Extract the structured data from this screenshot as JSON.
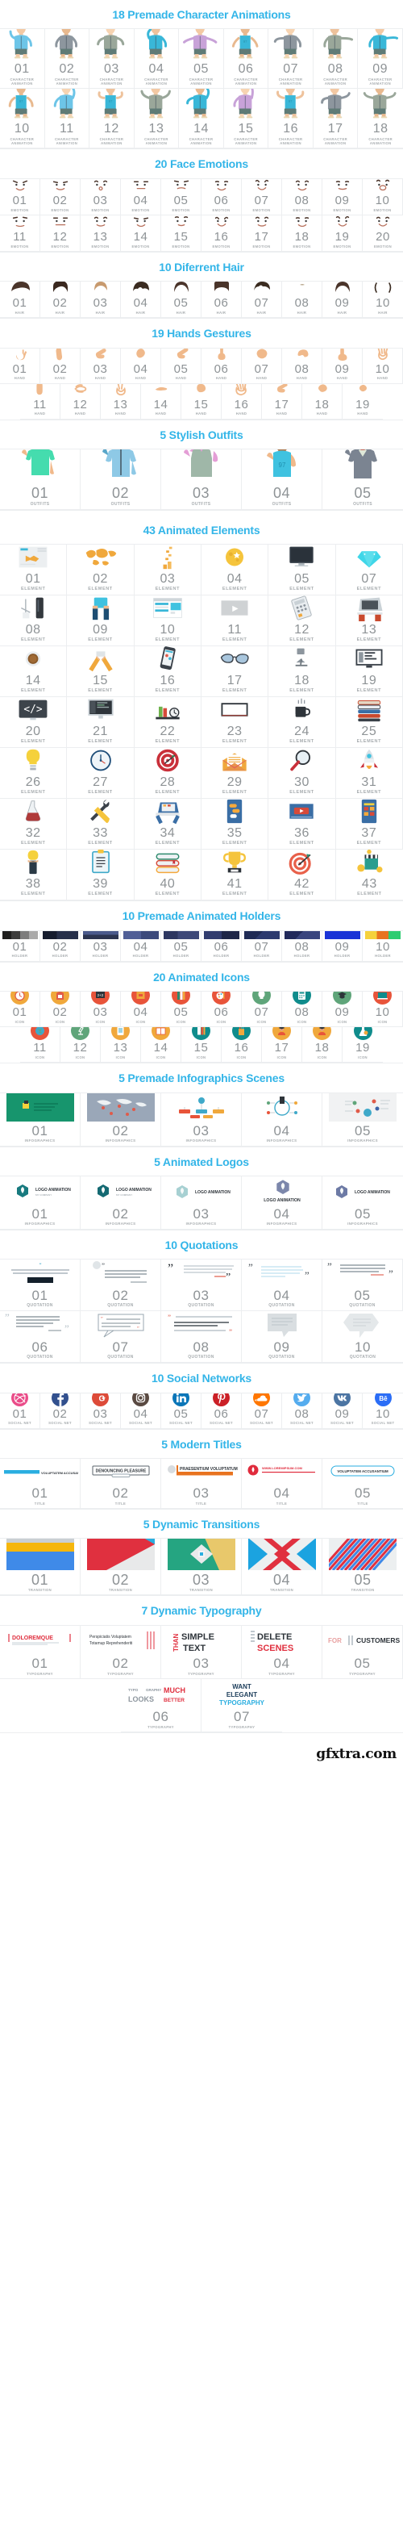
{
  "accent_color": "#33b5e8",
  "sections": [
    {
      "id": "characters",
      "title": "18 Premade Character Animations",
      "caption": "CHARACTER\nANIMATION",
      "items": [
        "01",
        "02",
        "03",
        "04",
        "05",
        "06",
        "07",
        "08",
        "09",
        "10",
        "11",
        "12",
        "13",
        "14",
        "15",
        "16",
        "17",
        "18"
      ]
    },
    {
      "id": "emotions",
      "title": "20 Face Emotions",
      "caption": "EMOTION",
      "items": [
        "01",
        "02",
        "03",
        "04",
        "05",
        "06",
        "07",
        "08",
        "09",
        "10",
        "11",
        "12",
        "13",
        "14",
        "15",
        "16",
        "17",
        "18",
        "19",
        "20"
      ]
    },
    {
      "id": "hair",
      "title": "10 Diferrent Hair",
      "caption": "HAIR",
      "items": [
        "01",
        "02",
        "03",
        "04",
        "05",
        "06",
        "07",
        "08",
        "09",
        "10"
      ]
    },
    {
      "id": "hands",
      "title": "19 Hands Gestures",
      "caption": "HAND",
      "items": [
        "01",
        "02",
        "03",
        "04",
        "05",
        "06",
        "07",
        "08",
        "09",
        "10",
        "11",
        "12",
        "13",
        "14",
        "15",
        "16",
        "17",
        "18",
        "19"
      ]
    },
    {
      "id": "outfits",
      "title": "5 Stylish Outfits",
      "caption": "OUTFITS",
      "items": [
        "01",
        "02",
        "03",
        "04",
        "05"
      ]
    },
    {
      "id": "elements",
      "title": "43 Animated Elements",
      "caption": "ELEMENT",
      "items": [
        "01",
        "02",
        "03",
        "04",
        "05",
        "07",
        "08",
        "09",
        "10",
        "11",
        "12",
        "13",
        "14",
        "15",
        "16",
        "17",
        "18",
        "19",
        "20",
        "21",
        "22",
        "23",
        "24",
        "25",
        "26",
        "27",
        "28",
        "29",
        "30",
        "31",
        "32",
        "33",
        "34",
        "35",
        "36",
        "37",
        "38",
        "39",
        "40",
        "41",
        "42",
        "43"
      ]
    },
    {
      "id": "holders",
      "title": "10 Premade Animated Holders",
      "caption": "HOLDER",
      "items": [
        "01",
        "02",
        "03",
        "04",
        "05",
        "06",
        "07",
        "08",
        "09",
        "10"
      ]
    },
    {
      "id": "icons",
      "title": "20 Animated Icons",
      "caption": "ICON",
      "items": [
        "01",
        "02",
        "03",
        "04",
        "05",
        "06",
        "07",
        "08",
        "09",
        "10",
        "11",
        "12",
        "13",
        "14",
        "15",
        "16",
        "17",
        "18",
        "19"
      ]
    },
    {
      "id": "infographics",
      "title": "5 Premade Infographics Scenes",
      "caption": "INFOGRAPHICS",
      "items": [
        "01",
        "02",
        "03",
        "04",
        "05"
      ]
    },
    {
      "id": "logos",
      "title": "5 Animated Logos",
      "caption": "INFOGRAPHICS",
      "items": [
        "01",
        "02",
        "03",
        "04",
        "05"
      ],
      "logo_text": "LOGO ANIMATION",
      "logo_sub": "MY COMPANY"
    },
    {
      "id": "quotations",
      "title": "10 Quotations",
      "caption": "QUOTATION",
      "items": [
        "01",
        "02",
        "03",
        "04",
        "05",
        "06",
        "07",
        "08",
        "09",
        "10"
      ]
    },
    {
      "id": "social",
      "title": "10 Social Networks",
      "caption": "SOCIAL NET",
      "items": [
        "01",
        "02",
        "03",
        "04",
        "05",
        "06",
        "07",
        "08",
        "09",
        "10"
      ],
      "networks": [
        "dribbble",
        "facebook",
        "google-plus",
        "instagram",
        "linkedin",
        "pinterest",
        "soundcloud",
        "twitter",
        "vk",
        "behance"
      ]
    },
    {
      "id": "titles",
      "title": "5 Modern Titles",
      "caption": "TITLE",
      "items": [
        "01",
        "02",
        "03",
        "04",
        "05"
      ],
      "labels": [
        "VOLUPTATEM ACCUSANTIUM",
        "DENOUNCING PLEASURE",
        "PRAESENTIUM VOLUPTATUM",
        "WWW.LOREMIPSUM.COM",
        "VOLUPTATEM ACCUSANTIUM"
      ]
    },
    {
      "id": "transitions",
      "title": "5 Dynamic Transitions",
      "caption": "TRANSITION",
      "items": [
        "01",
        "02",
        "03",
        "04",
        "05"
      ]
    },
    {
      "id": "typography",
      "title": "7 Dynamic Typography",
      "caption": "TYPOGRAPHY",
      "items": [
        "01",
        "02",
        "03",
        "04",
        "05",
        "06",
        "07"
      ],
      "labels": [
        "DOLOREMQUE",
        "Perspiciatis Voluptatem / Totamup Reprehenderiti",
        "THAN SIMPLE TEXT",
        "DELETE SCENES",
        "FOR CUSTOMERS",
        "TYPOGRAPHY LOOKS MUCH BETTER",
        "WANT ELEGANT TYPOGRAPHY"
      ]
    }
  ],
  "watermark": "gfxtra.com"
}
